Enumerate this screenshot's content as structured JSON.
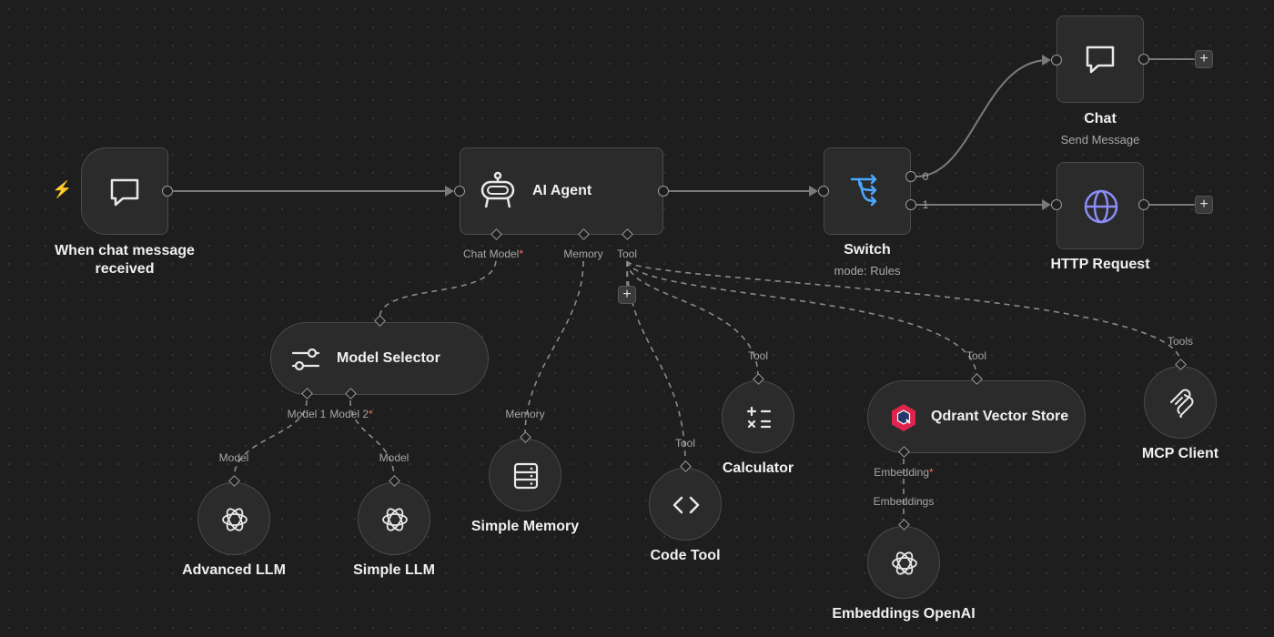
{
  "colors": {
    "canvas": "#1e1e1e",
    "node_bg": "#2b2b2b",
    "node_border": "#4a4a4a",
    "wire": "#7a7a7a",
    "required": "#ff6b6b",
    "switch_blue": "#4aa8ff",
    "globe_purple": "#8b8cf6",
    "trigger_orange": "#ff6d2d",
    "qdrant_red": "#dc244c"
  },
  "nodes": {
    "trigger": {
      "title": "When chat message received",
      "icon": "chat-bubble-icon",
      "badge_icon": "lightning-bolt-icon"
    },
    "agent": {
      "title": "AI Agent",
      "icon": "robot-icon",
      "ports": {
        "chat_model": "Chat Model",
        "required_mark": "*",
        "memory": "Memory",
        "tool": "Tool"
      }
    },
    "switch": {
      "title": "Switch",
      "subtitle": "mode: Rules",
      "icon": "switch-routes-icon",
      "outputs": [
        "0",
        "1"
      ]
    },
    "chat": {
      "title": "Chat",
      "subtitle": "Send Message",
      "icon": "chat-bubble-icon"
    },
    "http": {
      "title": "HTTP Request",
      "icon": "globe-icon"
    },
    "model_selector": {
      "title": "Model Selector",
      "icon": "sliders-icon",
      "ports": {
        "model1": "Model 1",
        "model2": "Model 2",
        "required_mark": "*"
      }
    },
    "advanced_llm": {
      "title": "Advanced LLM",
      "icon": "openai-icon",
      "port": "Model"
    },
    "simple_llm": {
      "title": "Simple LLM",
      "icon": "openai-icon",
      "port": "Model"
    },
    "simple_memory": {
      "title": "Simple Memory",
      "icon": "database-icon",
      "port": "Memory"
    },
    "code_tool": {
      "title": "Code Tool",
      "icon": "code-icon",
      "port": "Tool"
    },
    "calculator": {
      "title": "Calculator",
      "icon": "calculator-icon",
      "port": "Tool"
    },
    "qdrant": {
      "title": "Qdrant Vector Store",
      "icon": "qdrant-icon",
      "port": "Tool",
      "bottom_port": "Embedding",
      "required_mark": "*"
    },
    "embeddings": {
      "title": "Embeddings OpenAI",
      "icon": "openai-icon",
      "port": "Embeddings"
    },
    "mcp": {
      "title": "MCP Client",
      "icon": "mcp-icon",
      "port": "Tools"
    }
  },
  "controls": {
    "add_label": "+"
  }
}
